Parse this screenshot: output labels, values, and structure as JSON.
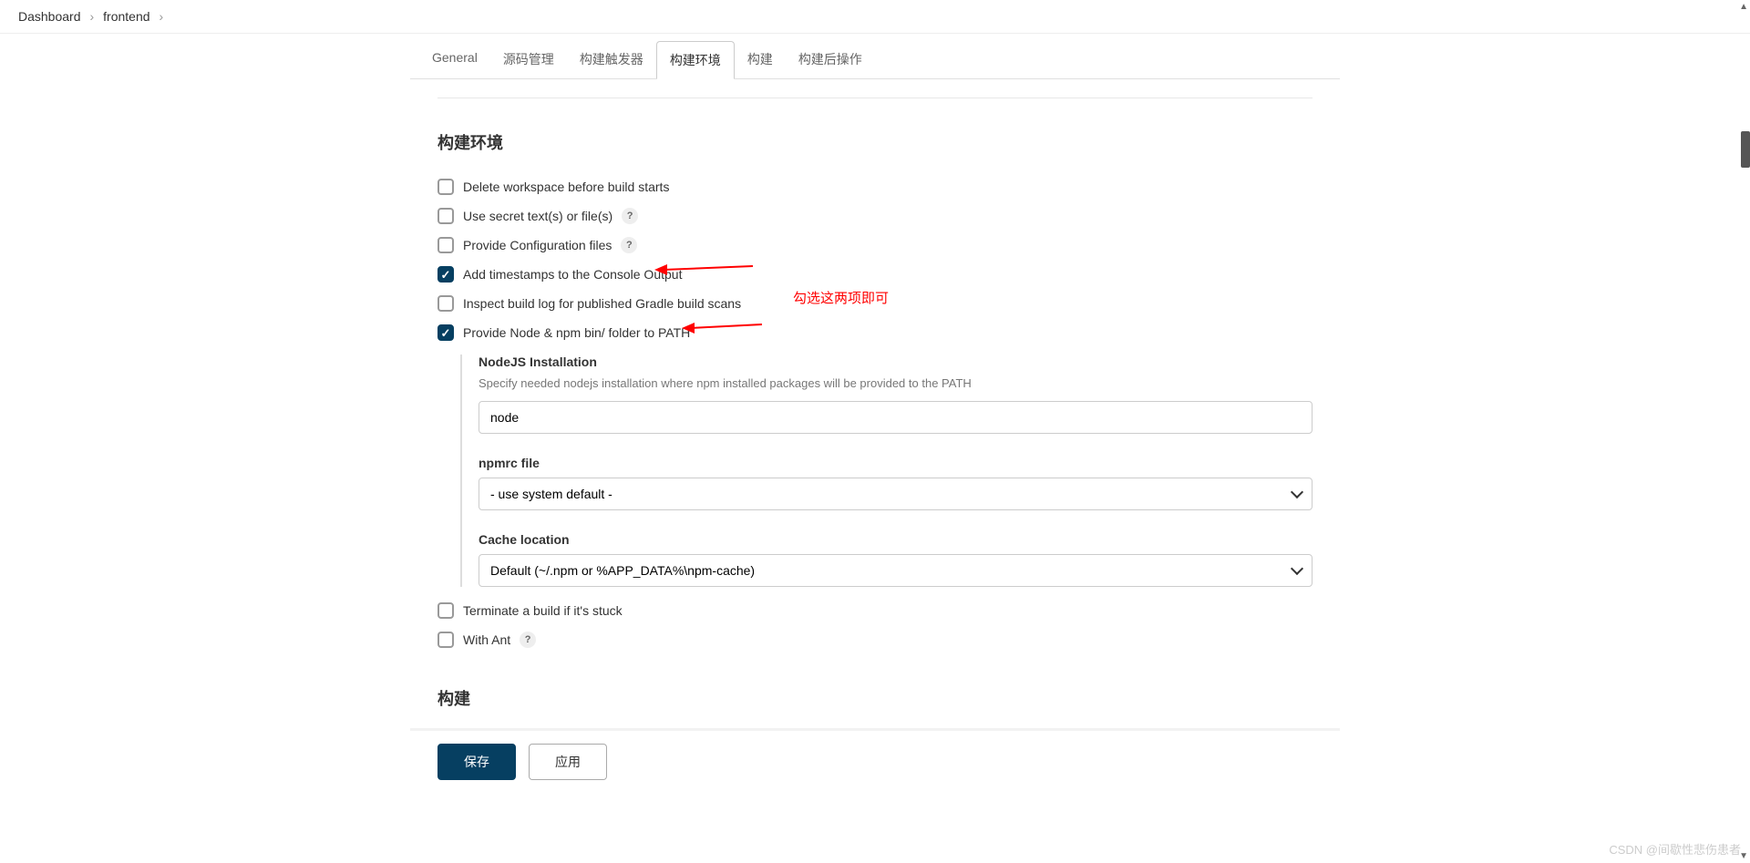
{
  "breadcrumb": {
    "dashboard": "Dashboard",
    "project": "frontend"
  },
  "tabs": {
    "general": "General",
    "scm": "源码管理",
    "triggers": "构建触发器",
    "env": "构建环境",
    "build": "构建",
    "post": "构建后操作"
  },
  "section": {
    "env_title": "构建环境",
    "build_title": "构建"
  },
  "options": {
    "delete_ws": "Delete workspace before build starts",
    "use_secret": "Use secret text(s) or file(s)",
    "provide_config": "Provide Configuration files",
    "add_timestamps": "Add timestamps to the Console Output",
    "inspect_gradle": "Inspect build log for published Gradle build scans",
    "provide_node": "Provide Node & npm bin/ folder to PATH",
    "terminate_stuck": "Terminate a build if it's stuck",
    "with_ant": "With Ant"
  },
  "annotation": "勾选这两项即可",
  "node_section": {
    "install_label": "NodeJS Installation",
    "install_desc": "Specify needed nodejs installation where npm installed packages will be provided to the PATH",
    "install_value": "node",
    "npmrc_label": "npmrc file",
    "npmrc_value": "- use system default -",
    "cache_label": "Cache location",
    "cache_value": "Default (~/.npm or %APP_DATA%\\npm-cache)"
  },
  "buttons": {
    "save": "保存",
    "apply": "应用"
  },
  "help_glyph": "?",
  "watermark": "CSDN @间歇性悲伤患者"
}
